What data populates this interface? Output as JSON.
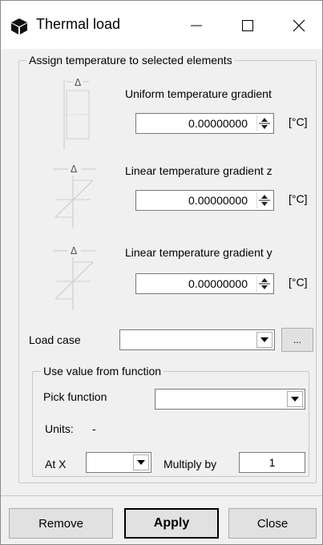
{
  "window": {
    "title": "Thermal load"
  },
  "group_assign": {
    "legend": "Assign temperature to selected elements",
    "uniform": {
      "label": "Uniform temperature gradient",
      "value": "0.00000000",
      "unit": "[°C]"
    },
    "linear_z": {
      "label": "Linear temperature gradient z",
      "value": "0.00000000",
      "unit": "[°C]"
    },
    "linear_y": {
      "label": "Linear temperature gradient y",
      "value": "0.00000000",
      "unit": "[°C]"
    },
    "load_case": {
      "label": "Load case",
      "value": "",
      "browse_label": "..."
    },
    "delta_symbol": "Δ"
  },
  "group_function": {
    "legend": "Use value from function",
    "pick_function": {
      "label": "Pick function",
      "value": ""
    },
    "units": {
      "label": "Units:",
      "value": "-"
    },
    "at_x": {
      "label": "At X",
      "value": ""
    },
    "multiply_by": {
      "label": "Multiply by",
      "value": "1"
    }
  },
  "buttons": {
    "remove": "Remove",
    "apply": "Apply",
    "close": "Close"
  }
}
